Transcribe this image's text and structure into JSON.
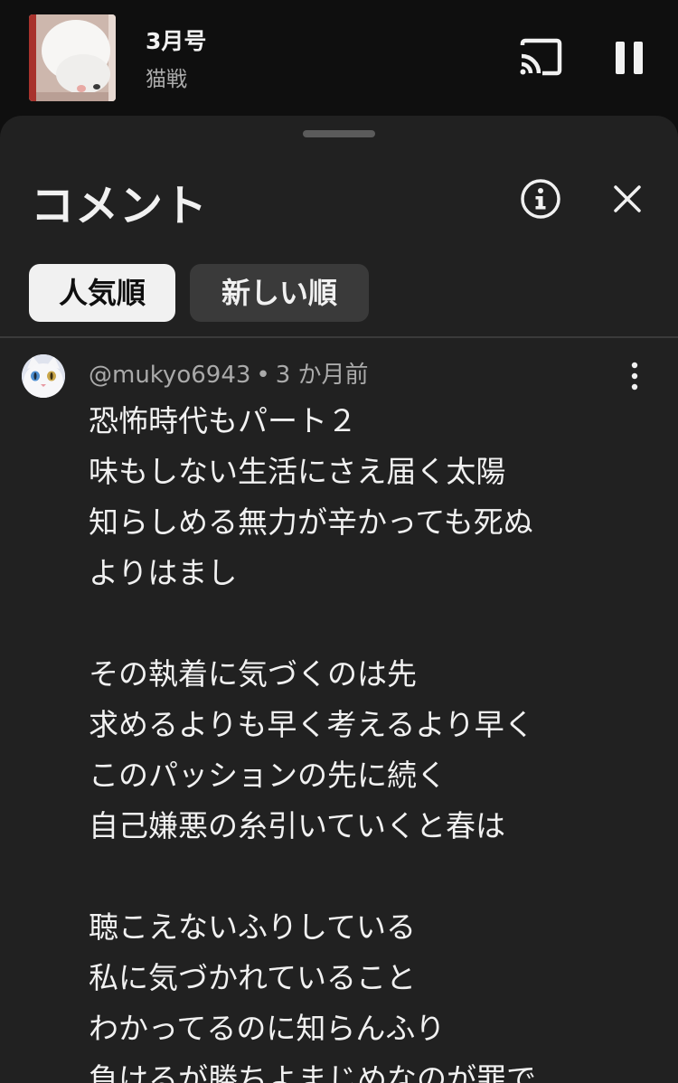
{
  "mini_player": {
    "title": "3月号",
    "artist": "猫戦",
    "thumbnail_icon": "cat-thumbnail",
    "cast_icon": "cast-icon",
    "pause_icon": "pause-icon"
  },
  "comments_panel": {
    "title": "コメント",
    "info_icon": "info-icon",
    "close_icon": "close-icon",
    "sort_chips": [
      {
        "label": "人気順",
        "selected": true
      },
      {
        "label": "新しい順",
        "selected": false
      }
    ]
  },
  "comment": {
    "author": "@mukyo6943",
    "separator": "•",
    "time": "3 か月前",
    "avatar_icon": "cat-avatar",
    "more_icon": "more-vert-icon",
    "lines": [
      "恐怖時代もパート２",
      "味もしない生活にさえ届く太陽",
      "知らしめる無力が辛かっても死ぬ",
      "よりはまし",
      "",
      "その執着に気づくのは先",
      "求めるよりも早く考えるより早く",
      "このパッションの先に続く",
      "自己嫌悪の糸引いていくと春は",
      "",
      "聴こえないふりしている",
      "私に気づかれていること",
      "わかってるのに知らんふり",
      "負けるが勝ちよまじめなのが罪で"
    ]
  },
  "colors": {
    "background": "#0f0f0f",
    "sheet": "#212121",
    "chip_selected": "#f1f1f1",
    "chip_unselected": "#3a3a3a",
    "secondary_text": "#aaaaaa"
  }
}
